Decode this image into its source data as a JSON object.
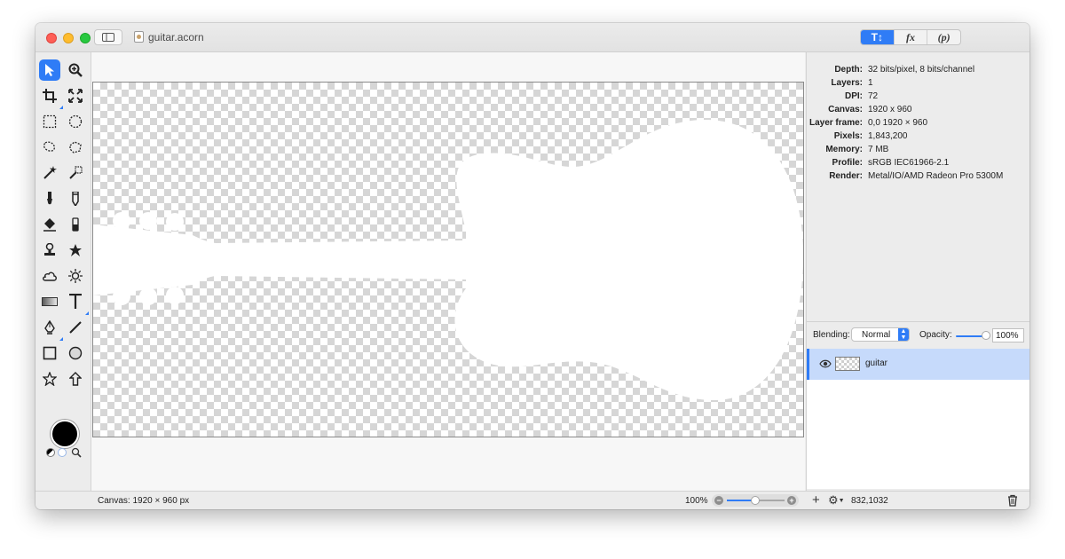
{
  "window": {
    "document_title": "guitar.acorn"
  },
  "inspector_tabs": [
    {
      "label": "T↕",
      "icon": "info-tools-icon",
      "active": true
    },
    {
      "label": "fx",
      "icon": "effects-icon",
      "active": false
    },
    {
      "label": "(p)",
      "icon": "properties-icon",
      "active": false
    }
  ],
  "tools": [
    "move-arrow-icon",
    "zoom-icon",
    "crop-icon",
    "resize-icon",
    "rect-select-icon",
    "ellipse-select-icon",
    "lasso-icon",
    "polygon-lasso-icon",
    "magic-wand-icon",
    "color-select-icon",
    "brush-icon",
    "pencil-icon",
    "paint-bucket-icon",
    "gradient-fill-icon",
    "clone-stamp-icon",
    "retouch-icon",
    "cloud-icon",
    "sun-icon",
    "gradient-icon",
    "text-tool-icon",
    "pen-icon",
    "line-icon",
    "rectangle-shape-icon",
    "oval-shape-icon",
    "star-icon",
    "arrow-up-icon"
  ],
  "colors": {
    "foreground": "#000000",
    "accent": "#2f7cf6",
    "layer_selected": "#c6dafb"
  },
  "info": [
    {
      "label": "Depth:",
      "value": "32 bits/pixel, 8 bits/channel"
    },
    {
      "label": "Layers:",
      "value": "1"
    },
    {
      "label": "DPI:",
      "value": "72"
    },
    {
      "label": "Canvas:",
      "value": "1920 x 960"
    },
    {
      "label": "Layer frame:",
      "value": "0,0 1920 × 960"
    },
    {
      "label": "Pixels:",
      "value": "1,843,200"
    },
    {
      "label": "Memory:",
      "value": "7 MB"
    },
    {
      "label": "Profile:",
      "value": "sRGB IEC61966-2.1"
    },
    {
      "label": "Render:",
      "value": "Metal/IO/AMD Radeon Pro 5300M"
    }
  ],
  "blending": {
    "label": "Blending:",
    "value": "Normal",
    "opacity_label": "Opacity:",
    "opacity_value": "100%"
  },
  "layers": [
    {
      "name": "guitar",
      "visible": true
    }
  ],
  "status": {
    "canvas": "Canvas: 1920 × 960 px",
    "zoom": "100%",
    "coords": "832,1032"
  }
}
